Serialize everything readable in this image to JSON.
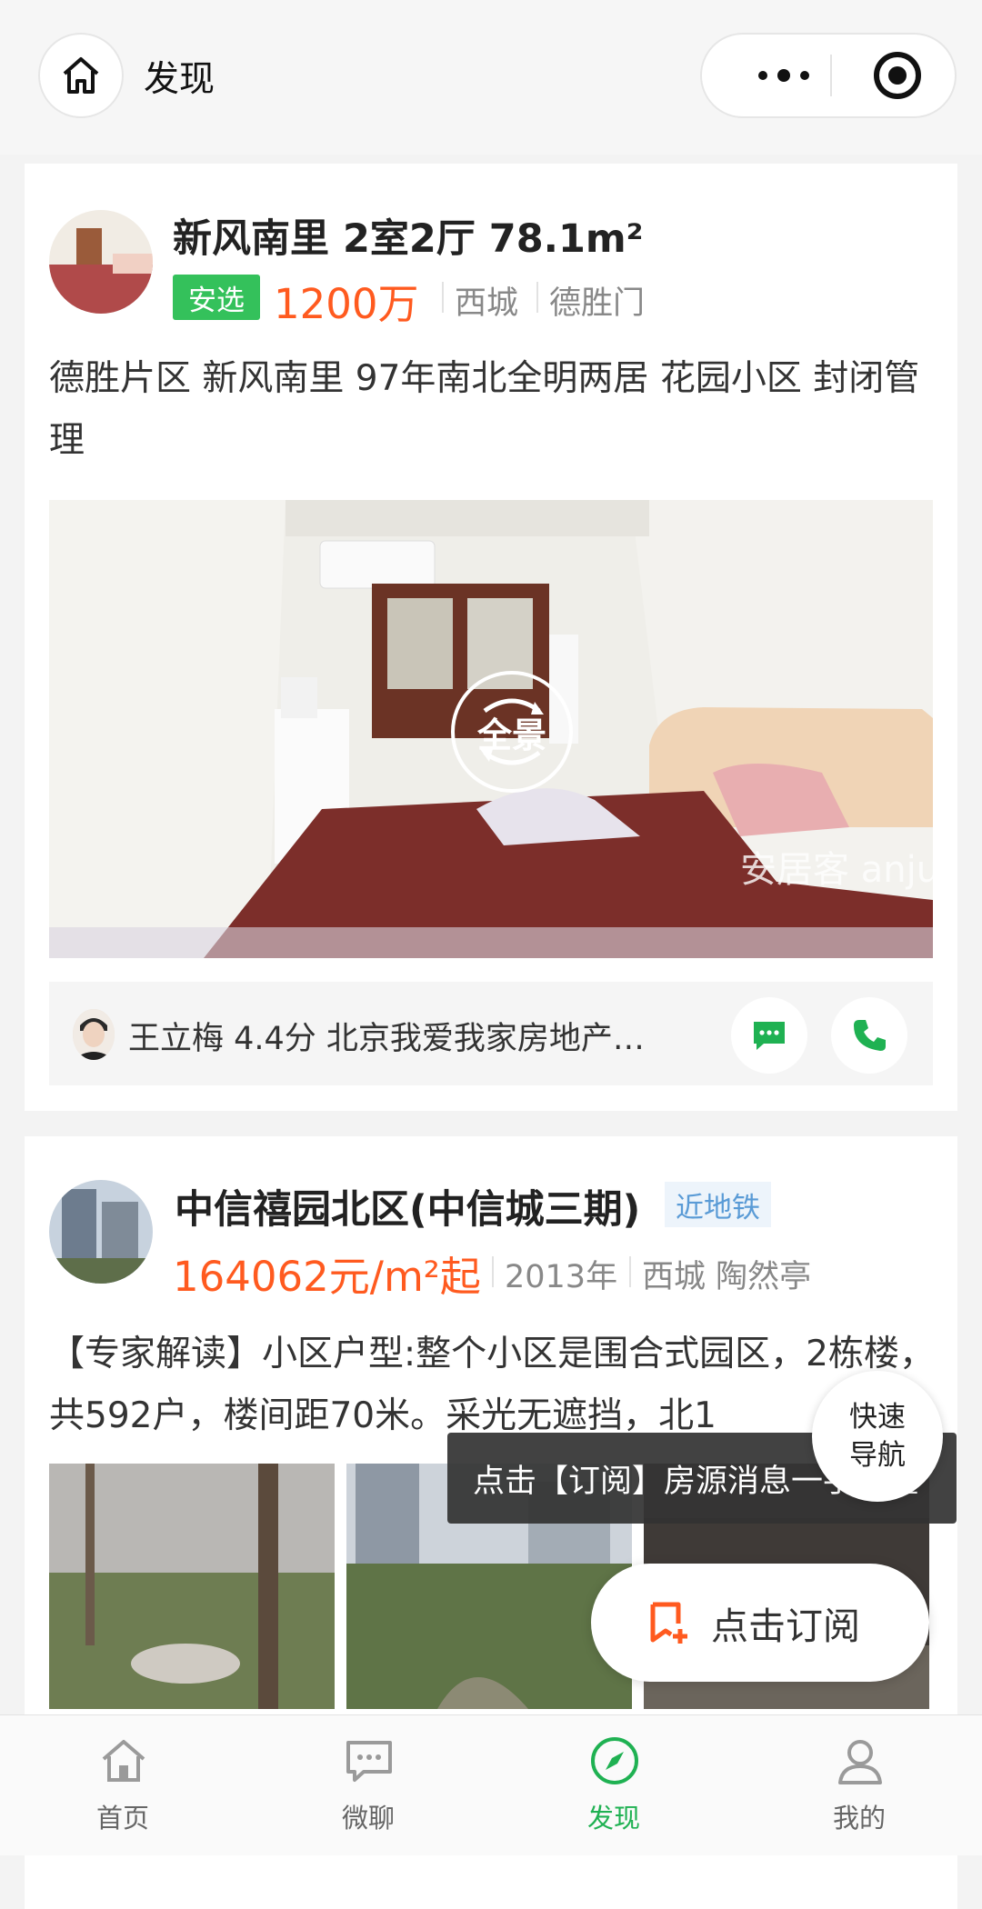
{
  "header": {
    "title": "发现"
  },
  "listing": {
    "title": "新风南里 2室2厅 78.1m²",
    "tag": "安选",
    "price": "1200万",
    "district": "西城",
    "area": "德胜门",
    "description": "德胜片区 新风南里 97年南北全明两居 花园小区 封闭管理",
    "panorama_label": "全景",
    "watermark": "安居客 anjuke.com",
    "agent": "王立梅 4.4分 北京我爱我家房地产经..."
  },
  "community": {
    "title": "中信禧园北区(中信城三期)",
    "tag": "近地铁",
    "price": "164062元/m²起",
    "year": "2013年",
    "location": "西城 陶然亭",
    "description": "【专家解读】小区户型:整个小区是围合式园区，2栋楼，共592户，楼间距70米。采光无遮挡，北1"
  },
  "overlay": {
    "fast_nav": "快速导航",
    "tooltip": "点击【订阅】房源消息一手掌握",
    "subscribe": "点击订阅"
  },
  "tabbar": {
    "items": [
      {
        "label": "首页",
        "icon": "home-icon"
      },
      {
        "label": "微聊",
        "icon": "chat-icon"
      },
      {
        "label": "发现",
        "icon": "compass-icon"
      },
      {
        "label": "我的",
        "icon": "user-icon"
      }
    ],
    "active": "发现",
    "active_color": "#1fb152"
  },
  "colors": {
    "price": "#ff5a1f",
    "tag_green": "#34c15b",
    "subway_tag": "#5a9bd6"
  }
}
